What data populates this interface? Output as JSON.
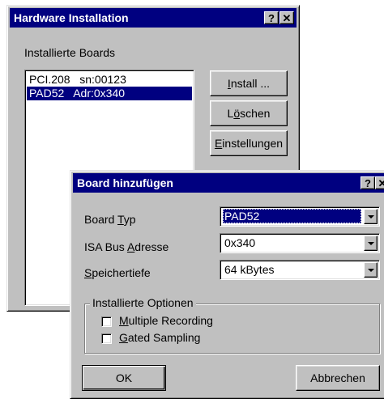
{
  "main_window": {
    "title": "Hardware Installation",
    "help_btn": "?",
    "close_btn": "✕",
    "boards_label": "Installierte Boards",
    "boards": [
      {
        "label": "PCI.208   sn:00123"
      },
      {
        "label": "PAD52   Adr:0x340"
      }
    ],
    "install_pre": "",
    "install_accel": "I",
    "install_post": "nstall ...",
    "delete_pre": "L",
    "delete_accel": "ö",
    "delete_post": "schen",
    "settings_pre": "",
    "settings_accel": "E",
    "settings_post": "instellungen"
  },
  "dialog": {
    "title": "Board hinzufügen",
    "help_btn": "?",
    "close_btn": "✕",
    "board_type_pre": "Board ",
    "board_type_accel": "T",
    "board_type_post": "yp",
    "board_type_value": "PAD52",
    "isa_pre": "ISA Bus ",
    "isa_accel": "A",
    "isa_post": "dresse",
    "isa_value": "0x340",
    "mem_pre": "",
    "mem_accel": "S",
    "mem_post": "peichertiefe",
    "mem_value": "64 kBytes",
    "options_title": "Installierte Optionen",
    "opt1_pre": "",
    "opt1_accel": "M",
    "opt1_post": "ultiple Recording",
    "opt2_pre": "",
    "opt2_accel": "G",
    "opt2_post": "ated Sampling",
    "ok": "OK",
    "cancel": "Abbrechen"
  }
}
